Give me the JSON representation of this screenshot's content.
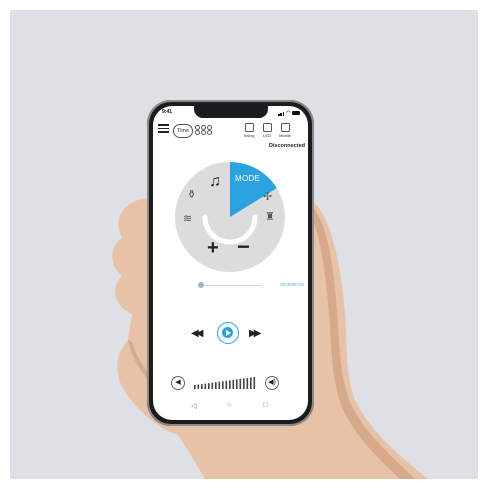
{
  "status_bar": {
    "time": "9:41"
  },
  "toolbar": {
    "time_label": "Time",
    "buttons": [
      {
        "label": "Swing",
        "icon": "swing-icon"
      },
      {
        "label": "LED",
        "icon": "led-icon"
      },
      {
        "label": "Mobile",
        "icon": "mobile-icon"
      }
    ]
  },
  "connection_status": "Disconnected",
  "wheel": {
    "mode_label": "MODE",
    "plus_label": "+",
    "minus_label": "−"
  },
  "progress": {
    "status_text": "00:00/00:00"
  },
  "colors": {
    "accent": "#2aa3e0",
    "wheel_bg": "#dcdcdc",
    "background": "#dfe0e5"
  }
}
